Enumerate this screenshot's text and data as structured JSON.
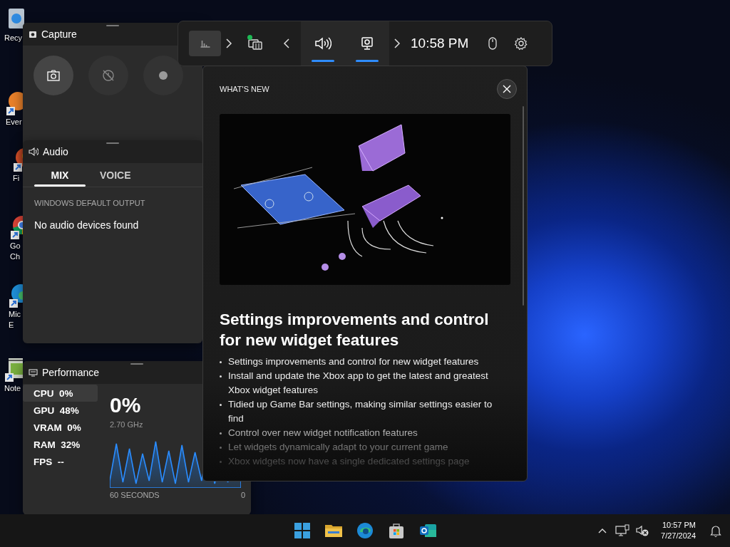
{
  "desktop_icons": [
    {
      "kind": "recycle-bin",
      "label_lines": [
        "Recy"
      ]
    },
    {
      "kind": "orange-app",
      "label_lines": [
        "Ever"
      ]
    },
    {
      "kind": "fox",
      "label_lines": [
        "Fi"
      ]
    },
    {
      "kind": "chrome",
      "label_lines": [
        "Go",
        "Ch"
      ]
    },
    {
      "kind": "edge",
      "label_lines": [
        "Mic",
        "E"
      ]
    },
    {
      "kind": "notepad",
      "label_lines": [
        "Note"
      ]
    }
  ],
  "game_bar": {
    "widget_menu": {
      "active": true
    },
    "launcher": [
      {
        "kind": "next"
      },
      {
        "kind": "capture",
        "badge": true
      },
      {
        "kind": "previous"
      }
    ],
    "pinned": [
      {
        "kind": "audio",
        "active": true
      },
      {
        "kind": "performance",
        "active": true
      }
    ],
    "trailing": [
      {
        "kind": "next"
      }
    ],
    "time": "10:58 PM",
    "controls": [
      {
        "kind": "mouse"
      },
      {
        "kind": "settings"
      }
    ]
  },
  "capture": {
    "title": "Capture",
    "buttons": [
      {
        "kind": "screenshot",
        "selected": true
      },
      {
        "kind": "record-last",
        "selected": false
      },
      {
        "kind": "record",
        "selected": false
      }
    ]
  },
  "audio": {
    "title": "Audio",
    "tabs": [
      {
        "label": "MIX",
        "selected": true
      },
      {
        "label": "VOICE",
        "selected": false
      }
    ],
    "section_label": "WINDOWS DEFAULT OUTPUT",
    "message": "No audio devices found"
  },
  "performance": {
    "title": "Performance",
    "stats": [
      {
        "name": "CPU",
        "value": "0%",
        "selected": true
      },
      {
        "name": "GPU",
        "value": "48%",
        "selected": false
      },
      {
        "name": "VRAM",
        "value": "0%",
        "selected": false
      },
      {
        "name": "RAM",
        "value": "32%",
        "selected": false
      },
      {
        "name": "FPS",
        "value": "--",
        "selected": false
      }
    ],
    "big_value": "0%",
    "frequency": "2.70 GHz",
    "duration_label": "60 SECONDS",
    "axis_min": "0"
  },
  "whats_new": {
    "title": "WHAT'S NEW",
    "heading": "Settings improvements and control for new widget features",
    "bullets": [
      "Settings improvements and control for new widget features",
      "Install and update the Xbox app to get the latest and greatest Xbox widget features",
      "Tidied up Game Bar settings, making similar settings easier to find",
      "Control over new widget notification features",
      "Let widgets dynamically adapt to your current game",
      "Xbox widgets now have a single dedicated settings page"
    ]
  },
  "taskbar": {
    "apps": [
      {
        "kind": "start"
      },
      {
        "kind": "folder"
      },
      {
        "kind": "edge"
      },
      {
        "kind": "store"
      },
      {
        "kind": "outlook"
      }
    ],
    "tray": [
      {
        "kind": "chevron"
      },
      {
        "kind": "network"
      },
      {
        "kind": "sound-off"
      }
    ],
    "time": "10:57 PM",
    "date": "7/27/2024"
  }
}
